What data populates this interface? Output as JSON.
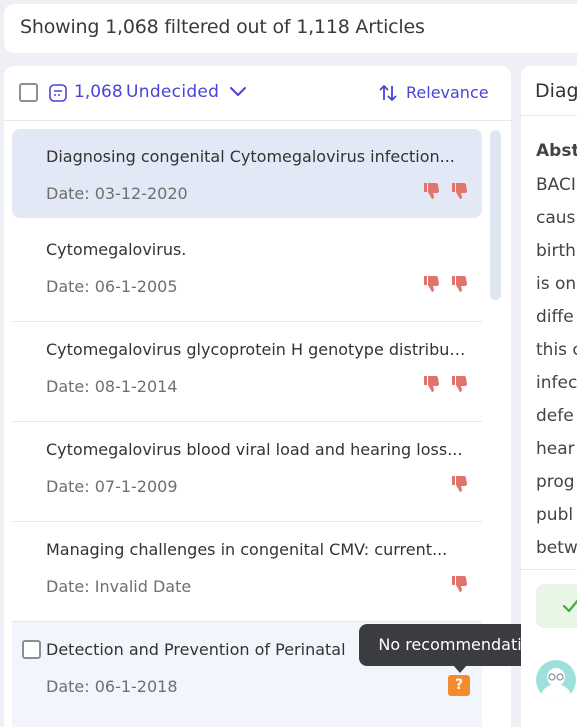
{
  "summary": {
    "text": "Showing 1,068 filtered out of 1,118 Articles"
  },
  "list_header": {
    "count": "1,068",
    "status": "Undecided",
    "sort_label": "Relevance"
  },
  "articles": [
    {
      "title": "Diagnosing congenital Cytomegalovirus infection...",
      "date": "Date: 03-12-2020",
      "thumbs_down": 2
    },
    {
      "title": "Cytomegalovirus.",
      "date": "Date: 06-1-2005",
      "thumbs_down": 2
    },
    {
      "title": "Cytomegalovirus glycoprotein H genotype distribution...",
      "date": "Date: 08-1-2014",
      "thumbs_down": 2
    },
    {
      "title": "Cytomegalovirus blood viral load and hearing loss...",
      "date": "Date: 07-1-2009",
      "thumbs_down": 1
    },
    {
      "title": "Managing challenges in congenital CMV: current...",
      "date": "Date: Invalid Date",
      "thumbs_down": 1
    },
    {
      "title": "Detection and Prevention of Perinatal",
      "date": "Date: 06-1-2018",
      "badge": "?"
    }
  ],
  "tooltip": {
    "text": "No recommendation"
  },
  "detail": {
    "title_partial": "Diag",
    "abstract_label": "Abst",
    "abstract_lines": [
      "BACI",
      "caus",
      "birth",
      "is on",
      "diffe",
      "this c",
      "infec",
      "defe",
      "hear",
      "prog",
      "publ",
      "betw"
    ]
  },
  "colors": {
    "accent": "#4a43d8",
    "thumb_down": "#e0736a",
    "badge": "#f28c2c",
    "selected_bg": "#e2e8f6"
  },
  "icons": {
    "filter": "filter-icon",
    "chevron": "chevron-down-icon",
    "sort": "sort-icon",
    "thumb": "thumbs-down-icon",
    "check": "check-icon",
    "avatar": "avatar-icon"
  }
}
